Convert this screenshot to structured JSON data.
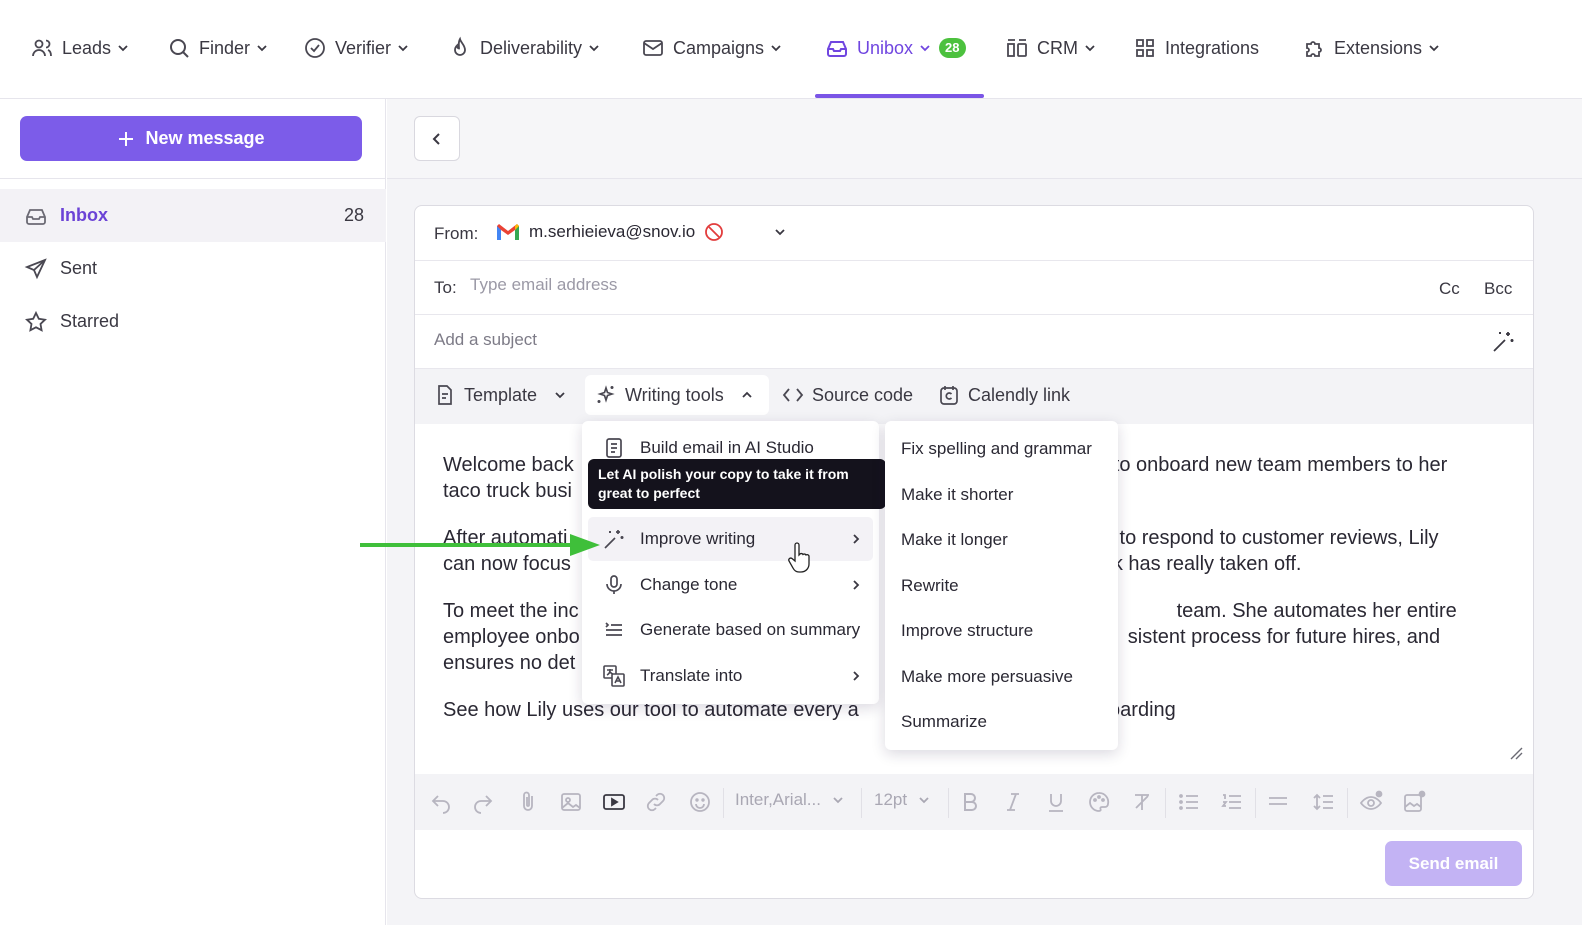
{
  "nav": {
    "items": [
      {
        "label": "Leads",
        "icon": "users-icon"
      },
      {
        "label": "Finder",
        "icon": "search-icon"
      },
      {
        "label": "Verifier",
        "icon": "check-circle-icon"
      },
      {
        "label": "Deliverability",
        "icon": "flame-icon"
      },
      {
        "label": "Campaigns",
        "icon": "mail-icon"
      },
      {
        "label": "Unibox",
        "icon": "inbox-icon",
        "badge": "28",
        "active": true
      },
      {
        "label": "CRM",
        "icon": "crm-icon"
      },
      {
        "label": "Integrations",
        "icon": "grid-icon"
      },
      {
        "label": "Extensions",
        "icon": "puzzle-icon"
      }
    ],
    "accent_color": "#7046e0",
    "badge_color": "#4cc13e"
  },
  "sidebar": {
    "new_message_label": "New message",
    "items": [
      {
        "label": "Inbox",
        "count": "28",
        "active": true
      },
      {
        "label": "Sent"
      },
      {
        "label": "Starred"
      }
    ]
  },
  "composer": {
    "from_label": "From:",
    "from_value": "m.serhieieva@snov.io",
    "to_label": "To:",
    "to_placeholder": "Type email address",
    "cc_label": "Cc",
    "bcc_label": "Bcc",
    "subject_placeholder": "Add a subject",
    "toolbar": {
      "template_label": "Template",
      "writing_tools_label": "Writing tools",
      "source_code_label": "Source code",
      "calendly_label": "Calendly link"
    },
    "body": {
      "p1": "Welcome back  to onboard new team members to her taco truck busi",
      "p1a": "Welcome back",
      "p1b": "to onboard new team members to her",
      "p1c": "taco truck busi",
      "p2a": "After automati",
      "p2b": "l to respond to customer reviews, Lily",
      "p2c": "can now focus",
      "p2d": "k has really taken off.",
      "p3a": "To meet the inc",
      "p3b": "team. She automates her entire",
      "p3c": "employee onbo",
      "p3d": "sistent process for future hires, and",
      "p3e": "ensures no det",
      "p4a": "See how Lily uses our tool to automate every a",
      "p4b": "nboarding"
    },
    "format_bar": {
      "font_value": "Inter,Arial...",
      "size_value": "12pt"
    },
    "send_label": "Send email"
  },
  "writing_menu": {
    "items": [
      {
        "label": "Build email in AI Studio",
        "icon": "document-icon"
      },
      {
        "label": "Improve writing",
        "icon": "magic-wand-icon",
        "has_submenu": true
      },
      {
        "label": "Change tone",
        "icon": "microphone-icon",
        "has_submenu": true
      },
      {
        "label": "Generate based on summary",
        "icon": "list-icon"
      },
      {
        "label": "Translate into",
        "icon": "translate-icon",
        "has_submenu": true
      }
    ],
    "tooltip": "Let AI polish your copy to take it from great to perfect"
  },
  "improve_submenu": {
    "items": [
      "Fix spelling and grammar",
      "Make it shorter",
      "Make it longer",
      "Rewrite",
      "Improve structure",
      "Make more persuasive",
      "Summarize"
    ]
  }
}
